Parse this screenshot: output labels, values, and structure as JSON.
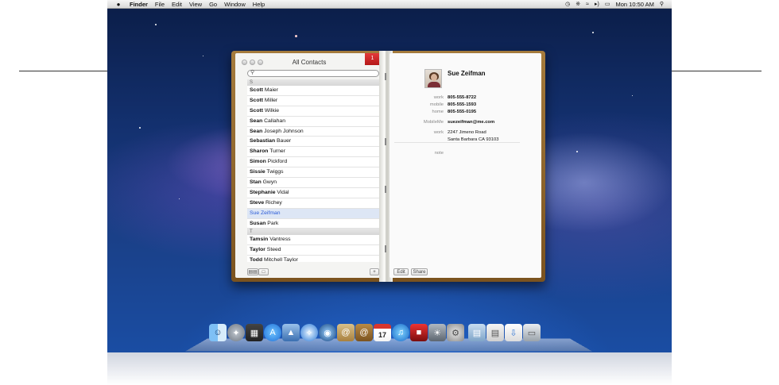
{
  "menubar": {
    "app_name": "Finder",
    "menus": [
      "File",
      "Edit",
      "View",
      "Go",
      "Window",
      "Help"
    ],
    "clock": "Mon 10:50 AM"
  },
  "window": {
    "title": "All Contacts",
    "bookmark_text": "1"
  },
  "contacts": {
    "sections": [
      {
        "letter": "S",
        "rows": [
          {
            "first": "Scott",
            "last": "Maier",
            "selected": false
          },
          {
            "first": "Scott",
            "last": "Miller",
            "selected": false
          },
          {
            "first": "Scott",
            "last": "Wilkie",
            "selected": false
          },
          {
            "first": "Sean",
            "last": "Callahan",
            "selected": false
          },
          {
            "first": "Sean",
            "last": "Joseph Johnson",
            "selected": false
          },
          {
            "first": "Sebastian",
            "last": "Bauer",
            "selected": false
          },
          {
            "first": "Sharon",
            "last": "Turner",
            "selected": false
          },
          {
            "first": "Simon",
            "last": "Pickford",
            "selected": false
          },
          {
            "first": "Sissie",
            "last": "Twiggs",
            "selected": false
          },
          {
            "first": "Stan",
            "last": "Gwyn",
            "selected": false
          },
          {
            "first": "Stephanie",
            "last": "Vidal",
            "selected": false
          },
          {
            "first": "Steve",
            "last": "Richey",
            "selected": false
          },
          {
            "first": "Sue",
            "last": "Zeifman",
            "selected": true
          },
          {
            "first": "Susan",
            "last": "Park",
            "selected": false
          }
        ]
      },
      {
        "letter": "T",
        "rows": [
          {
            "first": "Tamsin",
            "last": "Vantress",
            "selected": false
          },
          {
            "first": "Taylor",
            "last": "Steed",
            "selected": false
          },
          {
            "first": "Todd",
            "last": "Mitchell Taylor",
            "selected": false
          }
        ]
      }
    ],
    "add_label": "+"
  },
  "card": {
    "name": "Sue Zeifman",
    "fields": [
      {
        "label": "work",
        "value": "805-555-8722",
        "bold": true
      },
      {
        "label": "mobile",
        "value": "805-555-1593",
        "bold": true
      },
      {
        "label": "home",
        "value": "805-555-0195",
        "bold": true
      },
      {
        "label": "MobileMe",
        "value": "suezeifman@me.com",
        "bold": true
      },
      {
        "label": "work",
        "value": "2247 Jimeno Road",
        "bold": false
      },
      {
        "label": "",
        "value": "Santa Barbara CA 93103",
        "bold": false
      }
    ],
    "note_label": "note",
    "edit_label": "Edit",
    "share_label": "Share"
  },
  "dock": {
    "icons": [
      "finder-icon",
      "launchpad-icon",
      "mission-control-icon",
      "app-store-icon",
      "preview-icon",
      "safari-icon",
      "facetime-icon",
      "mail-icon",
      "address-book-icon",
      "ical-icon",
      "itunes-icon",
      "photo-booth-icon",
      "iphoto-icon",
      "system-preferences-icon",
      "applications-stack-icon",
      "documents-stack-icon",
      "downloads-stack-icon",
      "trash-icon"
    ],
    "ical_day": "17"
  }
}
